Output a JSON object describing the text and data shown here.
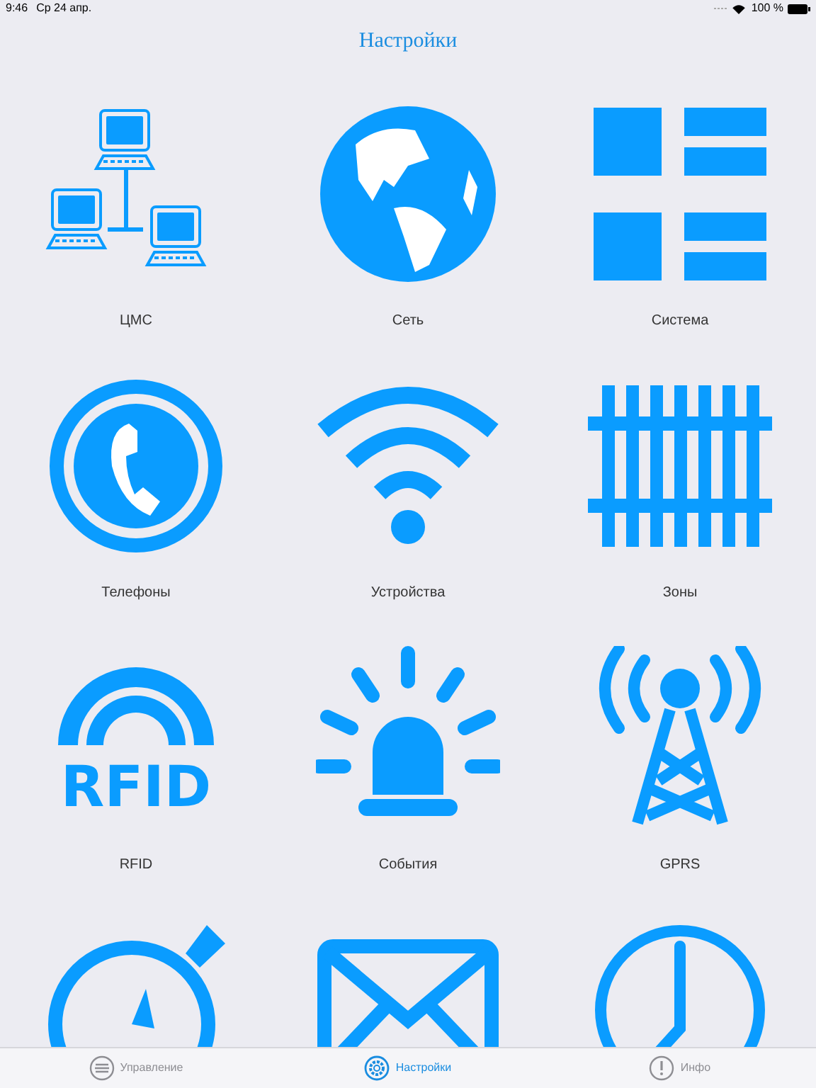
{
  "status_bar": {
    "time": "9:46",
    "date": "Ср 24 апр.",
    "battery": "100 %"
  },
  "title": "Настройки",
  "items": [
    {
      "kind": "network",
      "label": "ЦМС"
    },
    {
      "kind": "globe",
      "label": "Сеть"
    },
    {
      "kind": "system",
      "label": "Система"
    },
    {
      "kind": "phone",
      "label": "Телефоны"
    },
    {
      "kind": "wifi",
      "label": "Устройства"
    },
    {
      "kind": "rails",
      "label": "Зоны"
    },
    {
      "kind": "rfid",
      "label": "RFID",
      "icon_text": "RFID"
    },
    {
      "kind": "siren",
      "label": "События"
    },
    {
      "kind": "antenna",
      "label": "GPRS"
    },
    {
      "kind": "stopwatch"
    },
    {
      "kind": "mail"
    },
    {
      "kind": "clock"
    }
  ],
  "tabs": [
    {
      "kind": "list",
      "label": "Управление",
      "selected": false
    },
    {
      "kind": "gear",
      "label": "Настройки",
      "selected": true
    },
    {
      "kind": "info",
      "label": "Инфо",
      "selected": false
    }
  ]
}
